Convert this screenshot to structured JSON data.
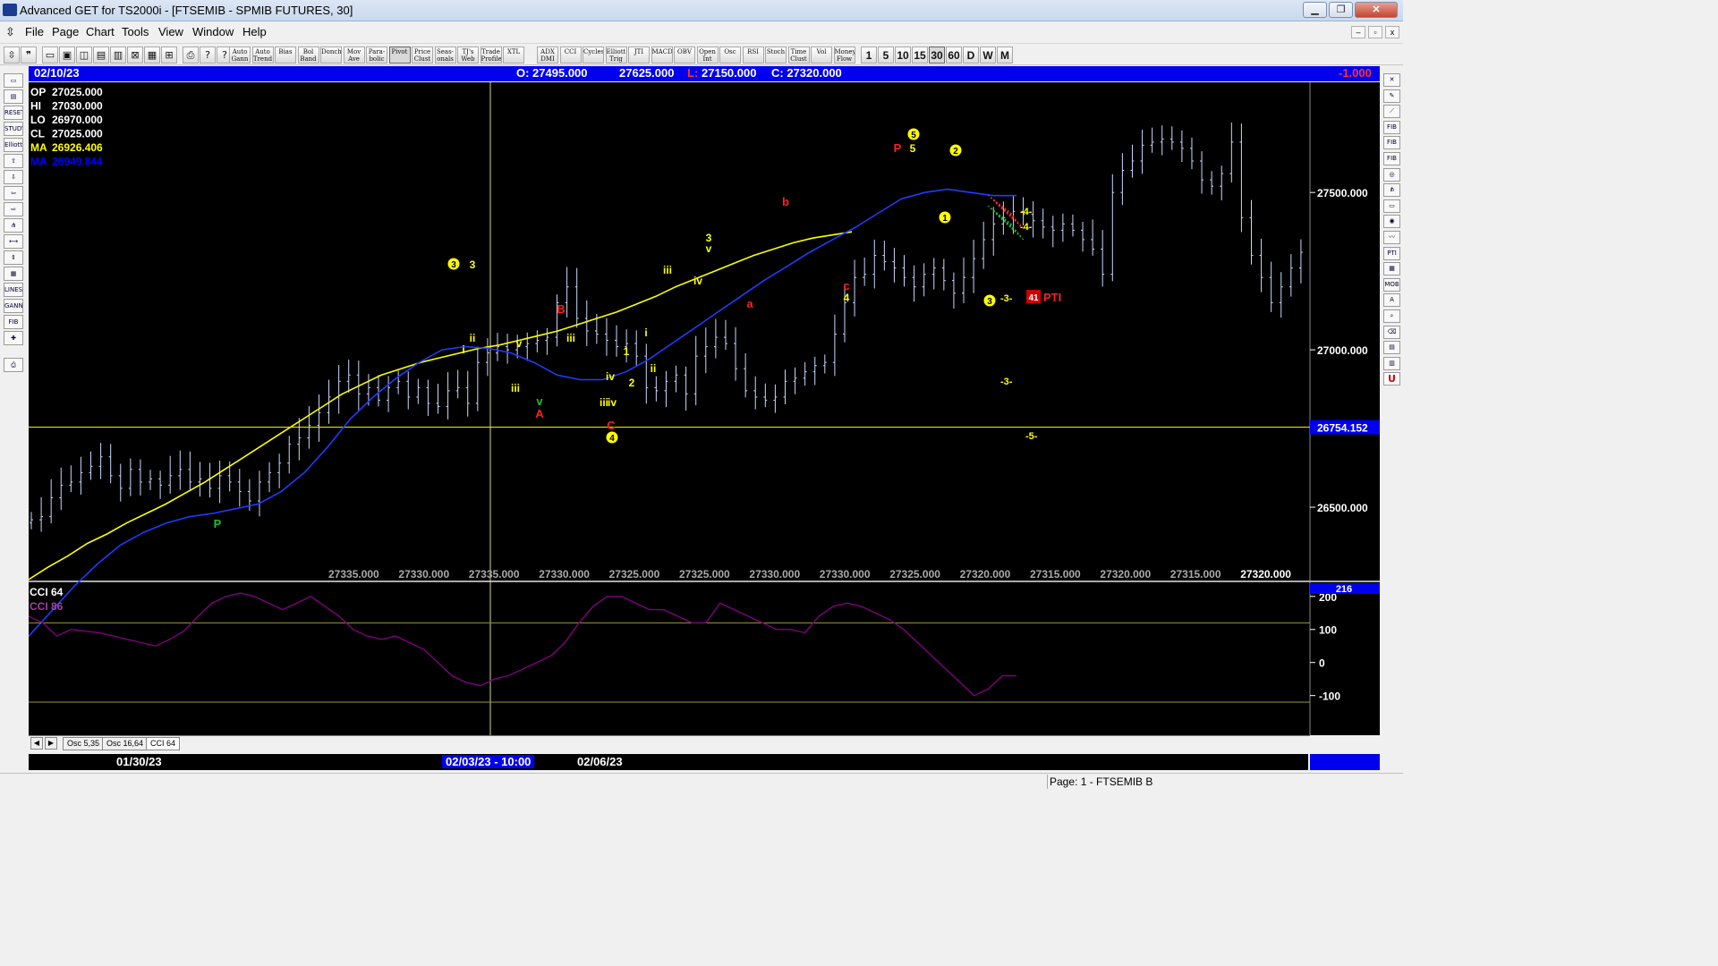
{
  "window": {
    "title": "Advanced GET for TS2000i - [FTSEMIB - SPMIB FUTURES, 30]"
  },
  "menu": [
    "File",
    "Page",
    "Chart",
    "Tools",
    "View",
    "Window",
    "Help"
  ],
  "toolbar": {
    "buttons": [
      "Auto Gann",
      "Auto Trend",
      "Bias",
      "Bol Band",
      "Donch",
      "Mov Ave",
      "Para-bolic",
      "Pivot",
      "Price Clust",
      "Seas-onals",
      "TJ's Web",
      "Trade Profile",
      "XTL",
      "ADX DMI",
      "CCI",
      "Cycles",
      "Elliott Trig",
      "JTI",
      "MACD",
      "OBV",
      "Open Int",
      "Osc",
      "RSI",
      "Stoch",
      "Time Clust",
      "Vol",
      "Money Flow"
    ],
    "timeframes": [
      "1",
      "5",
      "10",
      "15",
      "30",
      "60",
      "D",
      "W",
      "M"
    ],
    "active_timeframe": "30"
  },
  "info_bar": {
    "date": "02/10/23",
    "open": "O: 27495.000",
    "high": "27625.000",
    "low_label": "L:",
    "low": "27150.000",
    "close": "C: 27320.000",
    "change": "-1.000"
  },
  "readout": [
    {
      "label": "OP",
      "value": "27025.000",
      "color": "#ffffff"
    },
    {
      "label": "HI",
      "value": "27030.000",
      "color": "#ffffff"
    },
    {
      "label": "LO",
      "value": "26970.000",
      "color": "#ffffff"
    },
    {
      "label": "CL",
      "value": "27025.000",
      "color": "#ffffff"
    },
    {
      "label": "MA",
      "value": "26926.406",
      "color": "#ffff00"
    },
    {
      "label": "MA",
      "value": "26949.844",
      "color": "#0000ff"
    }
  ],
  "price_axis": [
    "27500.000",
    "27000.000",
    "26500.000"
  ],
  "current_price": "26754.152",
  "bottom_scale": [
    "27335.000",
    "27330.000",
    "27335.000",
    "27330.000",
    "27325.000",
    "27325.000",
    "27330.000",
    "27330.000",
    "27325.000",
    "27320.000",
    "27315.000",
    "27320.000",
    "27315.000",
    "27320.000"
  ],
  "pti": {
    "value": "41",
    "label": "PTI"
  },
  "projection_labels": [
    "-4-",
    "-4-",
    "-3-",
    "-3-",
    "-5-"
  ],
  "wave_labels": {
    "yellow": [
      "3",
      "ii",
      "i",
      "v",
      "iii",
      "iii",
      "iv",
      "1",
      "2",
      "i",
      "ii",
      "iii",
      "iv",
      "3",
      "v",
      "iii",
      "iv",
      "4",
      "5"
    ],
    "red": [
      "B",
      "A",
      "C",
      "b",
      "a",
      "c",
      "P"
    ],
    "green": [
      "P",
      "v"
    ],
    "circled": [
      "3",
      "4",
      "5",
      "1",
      "2",
      "3"
    ]
  },
  "indicator": {
    "title": "CCI 64",
    "subtitle": "CCI 86",
    "axis": [
      "200",
      "100",
      "0",
      "-100"
    ],
    "readout": "216",
    "tabs": [
      "Osc 5,35",
      "Osc 16,64",
      "CCI 64"
    ],
    "active_tab": "CCI 64"
  },
  "date_axis": {
    "d1": "01/30/23",
    "cursor": "02/03/23 - 10:00",
    "d2": "02/06/23"
  },
  "status": {
    "page": "Page: 1 - FTSEMIB B"
  },
  "colors": {
    "background": "#000000",
    "up_candle": "#c8d8ff",
    "ma_fast": "#ffff00",
    "ma_slow": "#1e3cff",
    "cci": "#800080",
    "info_bar": "#0000ee",
    "label_red": "#ff2020",
    "label_yellow": "#ffff00",
    "label_green": "#20c020"
  },
  "chart_data": {
    "type": "candlestick",
    "ylim": [
      26270,
      27850
    ],
    "series_close": [
      26460,
      26470,
      26530,
      26570,
      26580,
      26610,
      26630,
      26660,
      26600,
      26560,
      26620,
      26580,
      26590,
      26570,
      26600,
      26620,
      26580,
      26590,
      26560,
      26600,
      26580,
      26550,
      26520,
      26580,
      26610,
      26640,
      26700,
      26720,
      26760,
      26800,
      26850,
      26900,
      26920,
      26860,
      26880,
      26840,
      26880,
      26900,
      26850,
      26880,
      26830,
      26820,
      26870,
      26880,
      26830,
      26960,
      26990,
      27010,
      27000,
      27010,
      27020,
      27030,
      27040,
      27150,
      27200,
      27100,
      27060,
      27050,
      27030,
      27010,
      27020,
      26980,
      26880,
      26870,
      26900,
      26920,
      26860,
      26980,
      27010,
      27040,
      27020,
      26940,
      26870,
      26850,
      26840,
      26850,
      26900,
      26910,
      26930,
      26950,
      26960,
      27050,
      27150,
      27230,
      27240,
      27300,
      27280,
      27260,
      27230,
      27200,
      27240,
      27260,
      27220,
      27180,
      27230,
      27290,
      27350,
      27400,
      27420,
      27440,
      27430,
      27410,
      27390,
      27380,
      27400,
      27380,
      27350,
      27320,
      27240,
      27500,
      27570,
      27600,
      27650,
      27660,
      27670,
      27660,
      27640,
      27600,
      27540,
      27520,
      27560,
      27660,
      27420,
      27300,
      27230,
      27150,
      27200,
      27260,
      27310
    ],
    "ma_fast": [
      26270,
      26310,
      26345,
      26385,
      26415,
      26450,
      26480,
      26510,
      26545,
      26580,
      26620,
      26660,
      26700,
      26740,
      26780,
      26820,
      26860,
      26890,
      26920,
      26940,
      26960,
      26975,
      26990,
      27005,
      27015,
      27030,
      27045,
      27060,
      27080,
      27100,
      27120,
      27145,
      27170,
      27200,
      27225,
      27250,
      27275,
      27300,
      27320,
      27340,
      27355,
      27365,
      27375
    ],
    "ma_slow": [
      26090,
      26170,
      26250,
      26320,
      26380,
      26420,
      26450,
      26470,
      26480,
      26495,
      26510,
      26550,
      26610,
      26690,
      26780,
      26850,
      26910,
      26960,
      27000,
      27010,
      27005,
      26990,
      26960,
      26920,
      26905,
      26905,
      26930,
      26970,
      27020,
      27070,
      27120,
      27170,
      27220,
      27265,
      27310,
      27350,
      27390,
      27435,
      27480,
      27500,
      27510,
      27500,
      27490,
      27490
    ],
    "cci": [
      140,
      120,
      80,
      100,
      95,
      90,
      80,
      70,
      60,
      50,
      70,
      95,
      140,
      180,
      200,
      210,
      200,
      180,
      160,
      180,
      200,
      170,
      140,
      100,
      80,
      70,
      80,
      60,
      40,
      0,
      -40,
      -60,
      -70,
      -50,
      -40,
      -20,
      0,
      20,
      60,
      120,
      170,
      200,
      200,
      180,
      160,
      160,
      140,
      120,
      120,
      180,
      160,
      140,
      120,
      100,
      100,
      90,
      140,
      170,
      180,
      170,
      150,
      130,
      100,
      60,
      20,
      -20,
      -60,
      -100,
      -80,
      -40,
      -40
    ]
  }
}
